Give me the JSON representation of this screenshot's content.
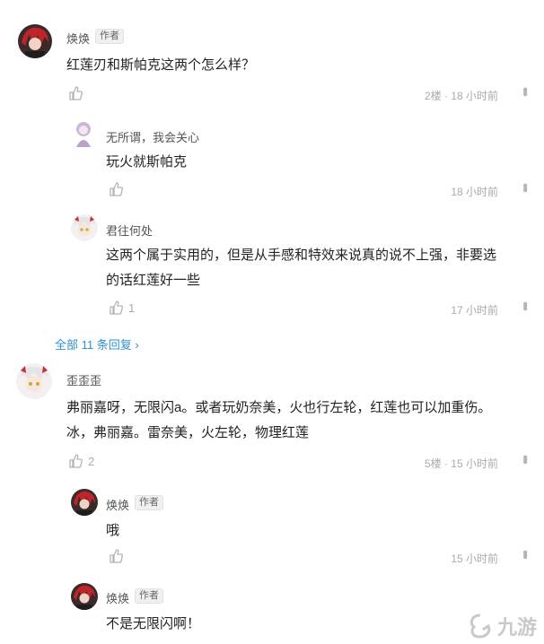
{
  "badge_label": "作者",
  "comments": [
    {
      "name": "焕焕",
      "text": "红莲刃和斯帕克这两个怎么样？",
      "likes": "",
      "meta": "2楼 · 18 小时前"
    },
    {
      "name": "无所谓，我会关心",
      "text": "玩火就斯帕克",
      "likes": "",
      "meta": "18 小时前"
    },
    {
      "name": "君往何处",
      "text_l1": "这两个属于实用的，但是从手感和特效来说真的说不上强，非要选",
      "text_l2": "的话红莲好一些",
      "likes": "1",
      "meta": "17 小时前"
    },
    {
      "name": "歪歪歪",
      "text_l1": "弗丽嘉呀，无限闪a。或者玩奶奈美，火也行左轮，红莲也可以加重伤。",
      "text_l2": "冰，弗丽嘉。雷奈美，火左轮，物理红莲",
      "likes": "2",
      "meta": "5楼 · 15 小时前"
    },
    {
      "name": "焕焕",
      "text": "哦",
      "likes": "",
      "meta": "15 小时前"
    },
    {
      "name": "焕焕",
      "text": "不是无限闪啊！",
      "likes": "",
      "meta": ""
    }
  ],
  "view_all": "全部 11 条回复 ›",
  "watermark": "九游",
  "colors": {
    "link": "#2f8fd1",
    "muted": "#aaaaaa"
  },
  "icons": {
    "like": "thumbs-up-icon",
    "more": "more-vertical-icon"
  }
}
